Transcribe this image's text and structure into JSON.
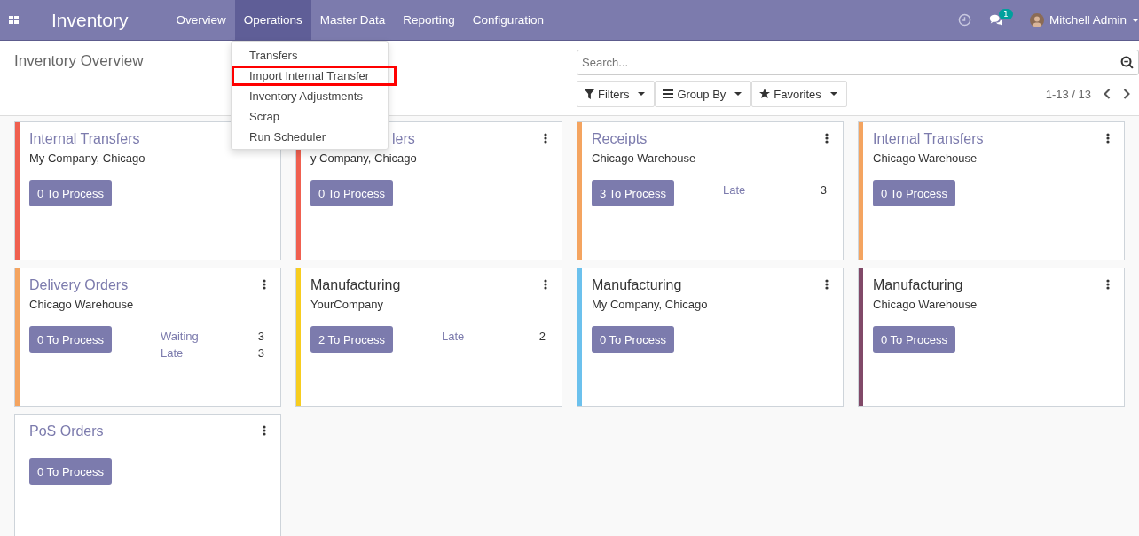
{
  "navbar": {
    "app_title": "Inventory",
    "menu": [
      {
        "label": "Overview",
        "selected": false
      },
      {
        "label": "Operations",
        "selected": true
      },
      {
        "label": "Master Data",
        "selected": false
      },
      {
        "label": "Reporting",
        "selected": false
      },
      {
        "label": "Configuration",
        "selected": false
      }
    ],
    "messages_badge": "1",
    "user": "Mitchell Admin"
  },
  "dropdown": [
    {
      "label": "Transfers",
      "highlighted": false
    },
    {
      "label": "Import Internal Transfer",
      "highlighted": true
    },
    {
      "label": "Inventory Adjustments",
      "highlighted": false
    },
    {
      "label": "Scrap",
      "highlighted": false
    },
    {
      "label": "Run Scheduler",
      "highlighted": false
    }
  ],
  "control_panel": {
    "title": "Inventory Overview",
    "search": {
      "placeholder": "Search..."
    },
    "filters": [
      "Filters",
      "Group By",
      "Favorites"
    ],
    "pager": "1-13 / 13"
  },
  "cards": [
    {
      "title": "Internal Transfers",
      "kind": "link",
      "subtitle": "My Company, Chicago",
      "color": "#f06050",
      "button": "0 To Process"
    },
    {
      "title": "lers",
      "kind": "link",
      "partly_hidden": true,
      "subtitle": "y Company, Chicago",
      "color": "#f06050",
      "button": "0 To Process"
    },
    {
      "title": "Receipts",
      "kind": "link",
      "subtitle": "Chicago Warehouse",
      "color": "#f4a460",
      "button": "3 To Process",
      "stats": [
        {
          "label": "Late",
          "value": "3"
        }
      ]
    },
    {
      "title": "Internal Transfers",
      "kind": "link",
      "subtitle": "Chicago Warehouse",
      "color": "#f4a460",
      "button": "0 To Process"
    },
    {
      "title": "Delivery Orders",
      "kind": "link",
      "subtitle": "Chicago Warehouse",
      "color": "#f4a460",
      "button": "0 To Process",
      "stats": [
        {
          "label": "Waiting",
          "value": "3"
        },
        {
          "label": "Late",
          "value": "3"
        }
      ]
    },
    {
      "title": "Manufacturing",
      "kind": "plain",
      "subtitle": "YourCompany",
      "color": "#f7cd1f",
      "button": "2 To Process",
      "stats": [
        {
          "label": "Late",
          "value": "2"
        }
      ]
    },
    {
      "title": "Manufacturing",
      "kind": "plain",
      "subtitle": "My Company, Chicago",
      "color": "#6cc1ed",
      "button": "0 To Process"
    },
    {
      "title": "Manufacturing",
      "kind": "plain",
      "subtitle": "Chicago Warehouse",
      "color": "#814968",
      "button": "0 To Process"
    },
    {
      "title": "PoS Orders",
      "kind": "link",
      "button": "0 To Process"
    }
  ]
}
